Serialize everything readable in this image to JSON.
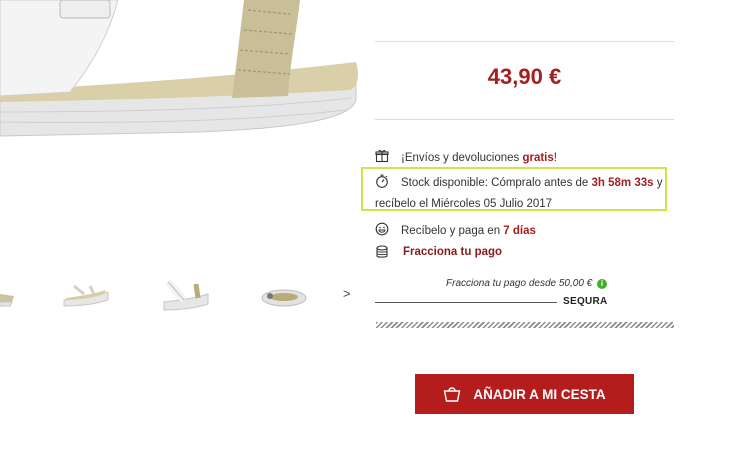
{
  "product": {
    "price": "43,90 €"
  },
  "info": {
    "shipping_prefix": "¡Envíos y devoluciones ",
    "shipping_free": "gratis",
    "shipping_suffix": "!",
    "stock_prefix": "Stock disponible: Cómpralo antes de ",
    "stock_countdown": "3h 58m 33s",
    "stock_suffix": " y",
    "delivery_date": "recíbelo el Miércoles 05 Julio 2017",
    "pay_later_prefix": "Recíbelo y paga en ",
    "pay_later_days": "7 días",
    "installments_link": "Fracciona tu pago"
  },
  "sequra": {
    "text": "Fracciona tu pago desde 50,00 €",
    "info_glyph": "i",
    "logo": "SEQURA"
  },
  "gallery": {
    "next_arrow": ">"
  },
  "actions": {
    "add_to_cart": "AÑADIR A MI CESTA"
  },
  "colors": {
    "accent_red": "#b51c1c",
    "price_red": "#a61e1e",
    "highlight": "#cfe34a",
    "info_green": "#3fae29"
  },
  "icons": [
    "gift-box-icon",
    "stopwatch-icon",
    "smiley-icon",
    "coins-icon",
    "shopping-bag-icon",
    "info-icon"
  ]
}
